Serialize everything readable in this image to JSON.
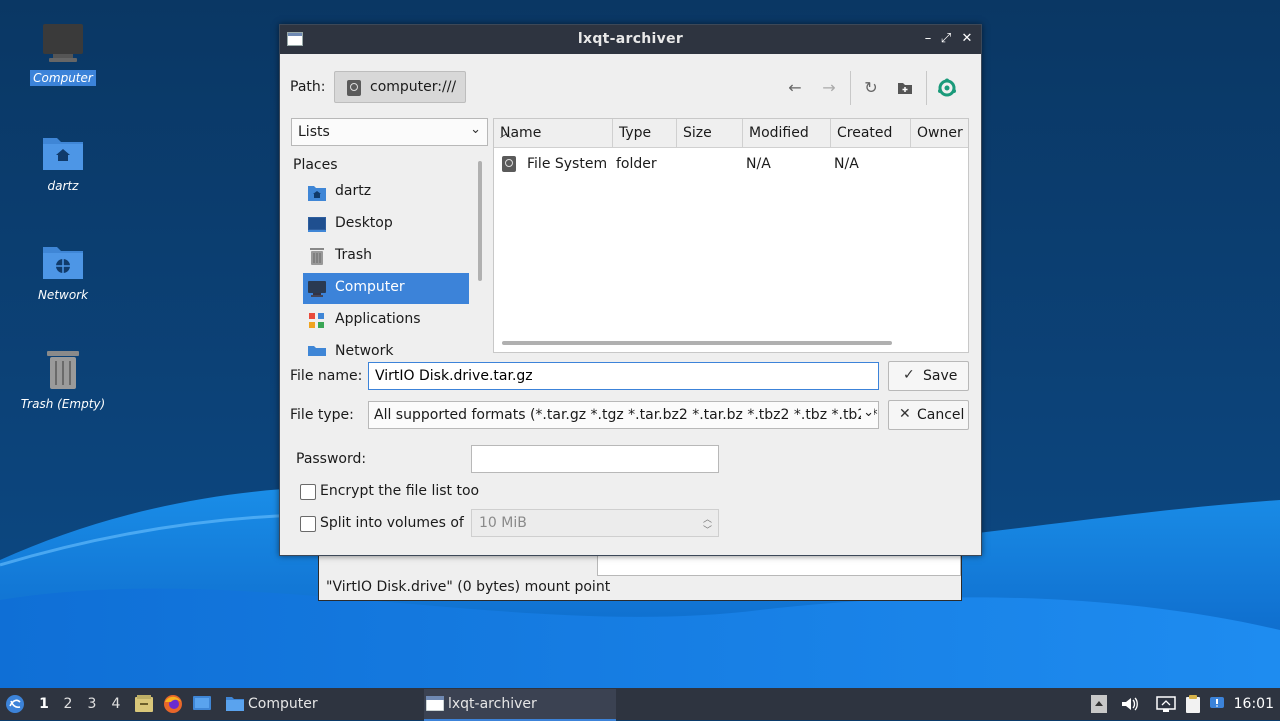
{
  "desktop": {
    "icons": [
      {
        "label": "Computer"
      },
      {
        "label": "dartz"
      },
      {
        "label": "Network"
      },
      {
        "label": "Trash (Empty)"
      }
    ]
  },
  "background_window": {
    "status_text": "\"VirtIO Disk.drive\" (0 bytes) mount point"
  },
  "dialog": {
    "title": "lxqt-archiver",
    "path_label": "Path:",
    "path_value": "computer:///",
    "view_mode": "Lists",
    "places_header": "Places",
    "places": [
      {
        "label": "dartz",
        "icon": "home-folder-icon"
      },
      {
        "label": "Desktop",
        "icon": "desktop-icon"
      },
      {
        "label": "Trash",
        "icon": "trash-icon"
      },
      {
        "label": "Computer",
        "icon": "computer-icon",
        "selected": true
      },
      {
        "label": "Applications",
        "icon": "applications-icon"
      },
      {
        "label": "Network",
        "icon": "network-folder-icon"
      }
    ],
    "columns": [
      "Name",
      "Type",
      "Size",
      "Modified",
      "Created",
      "Owner"
    ],
    "rows": [
      {
        "name": "File System",
        "type": "folder",
        "size": "",
        "modified": "N/A",
        "created": "N/A",
        "owner": ""
      }
    ],
    "file_name_label": "File name:",
    "file_name_value": "VirtIO Disk.drive.tar.gz",
    "file_type_label": "File type:",
    "file_type_value": "All supported formats (*.tar.gz *.tgz *.tar.bz2 *.tar.bz *.tbz2 *.tbz *.tb2 *.",
    "save_label": "Save",
    "cancel_label": "Cancel",
    "password_label": "Password:",
    "encrypt_label": "Encrypt the file list too",
    "split_label": "Split into volumes of",
    "split_value": "10 MiB"
  },
  "taskbar": {
    "workspaces": [
      "1",
      "2",
      "3",
      "4"
    ],
    "tasks": [
      {
        "label": "Computer"
      },
      {
        "label": "lxqt-archiver"
      }
    ],
    "clock": "16:01"
  },
  "colors": {
    "accent": "#3c83d9",
    "titlebar": "#2e3440",
    "taskbar": "#2e3440"
  }
}
